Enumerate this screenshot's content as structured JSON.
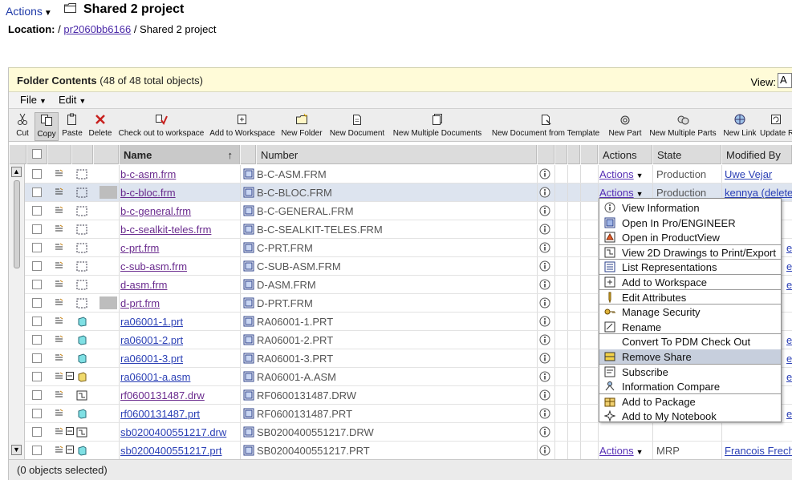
{
  "header": {
    "actions_label": "Actions",
    "title": "Shared 2 project",
    "location_label": "Location:",
    "location_sep1": " / ",
    "location_link": "pr2060bb6166",
    "location_sep2": " / ",
    "location_current": "Shared 2 project"
  },
  "panel": {
    "title_bold": "Folder Contents",
    "count": " (48 of 48 total objects)",
    "view_label": "View:",
    "view_value": "A"
  },
  "menubar": {
    "file": "File",
    "edit": "Edit"
  },
  "toolbar": [
    {
      "label": "Cut",
      "icon": "scissors-icon"
    },
    {
      "label": "Copy",
      "icon": "copy-icon"
    },
    {
      "label": "Paste",
      "icon": "paste-icon"
    },
    {
      "label": "Delete",
      "icon": "delete-x-icon"
    },
    {
      "label": "Check out to workspace",
      "icon": "checkout-icon"
    },
    {
      "label": "Add to Workspace",
      "icon": "add-workspace-icon"
    },
    {
      "label": "New Folder",
      "icon": "new-folder-icon"
    },
    {
      "label": "New Document",
      "icon": "new-document-icon"
    },
    {
      "label": "New Multiple Documents",
      "icon": "new-multiple-documents-icon"
    },
    {
      "label": "New Document from Template",
      "icon": "new-document-template-icon"
    },
    {
      "label": "New Part",
      "icon": "new-part-icon"
    },
    {
      "label": "New Multiple Parts",
      "icon": "new-multiple-parts-icon"
    },
    {
      "label": "New Link",
      "icon": "new-link-icon"
    },
    {
      "label": "Update R",
      "icon": "update-icon"
    }
  ],
  "columns": {
    "name": "Name",
    "sort_indicator": "↑",
    "number": "Number",
    "actions": "Actions",
    "state": "State",
    "modified_by": "Modified By"
  },
  "rows": [
    {
      "name": "b-c-asm.frm",
      "number": "B-C-ASM.FRM",
      "actions": "Actions",
      "state": "Production",
      "modified": "Uwe Vejar",
      "kind": "frm",
      "visited": true
    },
    {
      "name": "b-c-bloc.frm",
      "number": "B-C-BLOC.FRM",
      "actions": "Actions",
      "state": "Production",
      "modified": "kennya (delete",
      "kind": "frm",
      "visited": true,
      "selected": true
    },
    {
      "name": "b-c-general.frm",
      "number": "B-C-GENERAL.FRM",
      "actions": "",
      "state": "",
      "modified": "",
      "kind": "frm",
      "visited": true
    },
    {
      "name": "b-c-sealkit-teles.frm",
      "number": "B-C-SEALKIT-TELES.FRM",
      "actions": "",
      "state": "",
      "modified": "",
      "kind": "frm",
      "visited": true
    },
    {
      "name": "c-prt.frm",
      "number": "C-PRT.FRM",
      "actions": "",
      "state": "",
      "modified": "",
      "kind": "frm",
      "visited": true
    },
    {
      "name": "c-sub-asm.frm",
      "number": "C-SUB-ASM.FRM",
      "actions": "",
      "state": "",
      "modified": "",
      "kind": "frm",
      "visited": true
    },
    {
      "name": "d-asm.frm",
      "number": "D-ASM.FRM",
      "actions": "",
      "state": "",
      "modified": "",
      "kind": "frm",
      "visited": true
    },
    {
      "name": "d-prt.frm",
      "number": "D-PRT.FRM",
      "actions": "",
      "state": "",
      "modified": "",
      "kind": "frm",
      "visited": true
    },
    {
      "name": "ra06001-1.prt",
      "number": "RA06001-1.PRT",
      "actions": "",
      "state": "",
      "modified": "",
      "kind": "prt",
      "visited": false
    },
    {
      "name": "ra06001-2.prt",
      "number": "RA06001-2.PRT",
      "actions": "",
      "state": "",
      "modified": "",
      "kind": "prt",
      "visited": false
    },
    {
      "name": "ra06001-3.prt",
      "number": "RA06001-3.PRT",
      "actions": "",
      "state": "",
      "modified": "",
      "kind": "prt",
      "visited": false
    },
    {
      "name": "ra06001-a.asm",
      "number": "RA06001-A.ASM",
      "actions": "",
      "state": "",
      "modified": "",
      "kind": "asm",
      "visited": false
    },
    {
      "name": "rf0600131487.drw",
      "number": "RF0600131487.DRW",
      "actions": "",
      "state": "",
      "modified": "",
      "kind": "drw",
      "visited": true
    },
    {
      "name": "rf0600131487.prt",
      "number": "RF0600131487.PRT",
      "actions": "",
      "state": "",
      "modified": "",
      "kind": "prt",
      "visited": false
    },
    {
      "name": "sb0200400551217.drw",
      "number": "SB0200400551217.DRW",
      "actions": "",
      "state": "",
      "modified": "",
      "kind": "drw",
      "visited": false
    },
    {
      "name": "sb0200400551217.prt",
      "number": "SB0200400551217.PRT",
      "actions": "Actions",
      "state": "MRP",
      "modified": "Francois Frech",
      "kind": "prt",
      "visited": false
    }
  ],
  "dropdown": [
    {
      "label": "View Information",
      "icon": "info-icon"
    },
    {
      "label": "Open In Pro/ENGINEER",
      "icon": "proe-icon"
    },
    {
      "label": "Open in ProductView",
      "icon": "productview-icon"
    },
    {
      "label": "View 2D Drawings to Print/Export",
      "icon": "drawing-icon",
      "sep_before": true
    },
    {
      "label": "List Representations",
      "icon": "representations-icon",
      "sep_before": true
    },
    {
      "label": "Add to Workspace",
      "icon": "add-workspace-icon",
      "sep_before": true
    },
    {
      "label": "Edit Attributes",
      "icon": "pencil-icon",
      "sep_before": true
    },
    {
      "label": "Manage Security",
      "icon": "key-icon",
      "sep_before": true
    },
    {
      "label": "Rename",
      "icon": "rename-icon"
    },
    {
      "label": "Convert To PDM Check Out",
      "icon": "",
      "sep_before": true
    },
    {
      "label": "Remove Share",
      "icon": "remove-share-icon",
      "highlight": true
    },
    {
      "label": "Subscribe",
      "icon": "subscribe-icon",
      "sep_before": true
    },
    {
      "label": "Information Compare",
      "icon": "compare-icon"
    },
    {
      "label": "Add to Package",
      "icon": "package-icon",
      "sep_before": true
    },
    {
      "label": "Add to My Notebook",
      "icon": "notebook-icon"
    }
  ],
  "right_edge_letters": [
    "e",
    "e",
    "e",
    "e",
    "e",
    "e",
    "e"
  ],
  "status": "(0 objects selected)",
  "colors": {
    "link": "#4b2aa8",
    "panel_bg": "#fffbd8",
    "selected_row": "#dde4ef",
    "menu_highlight": "#c7cfdd"
  }
}
